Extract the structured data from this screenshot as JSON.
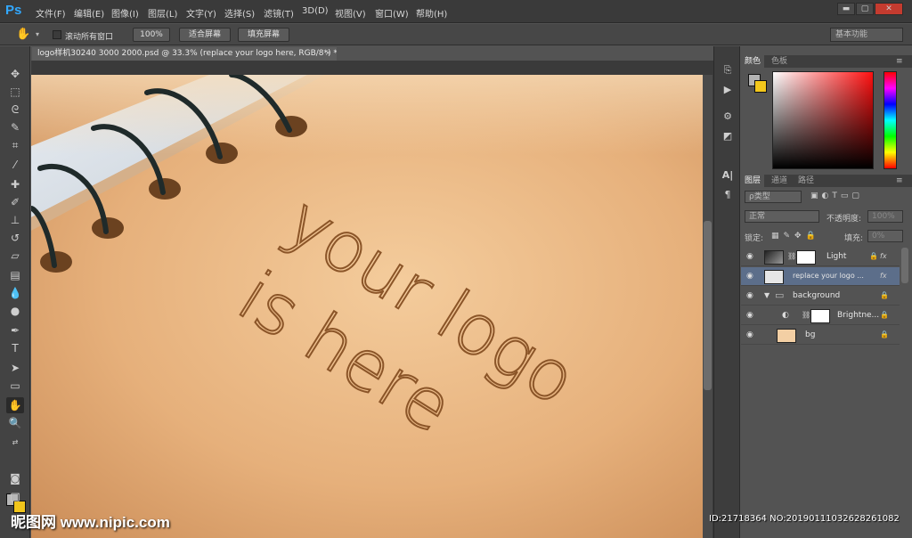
{
  "app": {
    "logo": "Ps"
  },
  "menu": [
    "文件(F)",
    "编辑(E)",
    "图像(I)",
    "图层(L)",
    "文字(Y)",
    "选择(S)",
    "滤镜(T)",
    "3D(D)",
    "视图(V)",
    "窗口(W)",
    "帮助(H)"
  ],
  "window_controls": {
    "minimize": "▬",
    "restore": "▢",
    "close": "✕"
  },
  "options": {
    "scroll_all_label": "滚动所有窗口",
    "zoom_100": "100%",
    "fit_screen": "适合屏幕",
    "fill_screen": "填充屏幕",
    "workspace": "基本功能"
  },
  "document": {
    "tab_title": "logo样机30240 3000 2000.psd @ 33.3% (replace your logo here, RGB/8*) *",
    "close": "×",
    "logo_text_line1": "your logo",
    "logo_text_line2": "is here"
  },
  "color_panel": {
    "tabs": [
      "颜色",
      "色板"
    ]
  },
  "layers_panel": {
    "tabs": [
      "图层",
      "通道",
      "路径"
    ],
    "filter_kind": "ρ类型",
    "blend_mode": "正常",
    "opacity_label": "不透明度:",
    "opacity_value": "100%",
    "lock_label": "锁定:",
    "fill_label": "填充:",
    "fill_value": "0%",
    "layers": [
      {
        "name": "Light",
        "fx": "fx"
      },
      {
        "name": "replace your logo ...",
        "fx": "fx"
      },
      {
        "name": "background"
      },
      {
        "name": "Brightne..."
      },
      {
        "name": "bg"
      }
    ]
  },
  "colors": {
    "fg": "#b3b3b3",
    "bg": "#f3c81c",
    "accent": "#32a8ff"
  },
  "watermark": "昵图网 www.nipic.com",
  "image_id": "ID:21718364 NO:20190111032628261082"
}
